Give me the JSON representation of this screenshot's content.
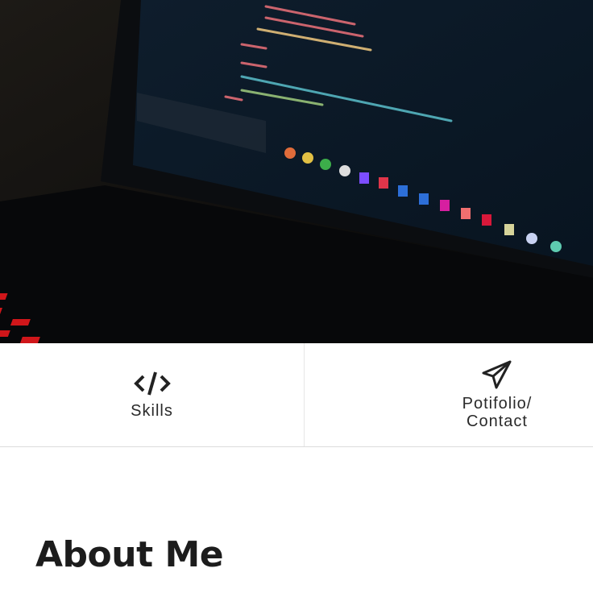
{
  "hero": {
    "alt": "Laptop with code on screen and red backlit keyboard"
  },
  "nav": {
    "items": [
      {
        "label": "Skills",
        "icon": "code-icon"
      },
      {
        "label_line1": "Potifolio/",
        "label_line2": "Contact",
        "icon": "paper-plane-icon"
      }
    ]
  },
  "about": {
    "title": "About Me"
  }
}
